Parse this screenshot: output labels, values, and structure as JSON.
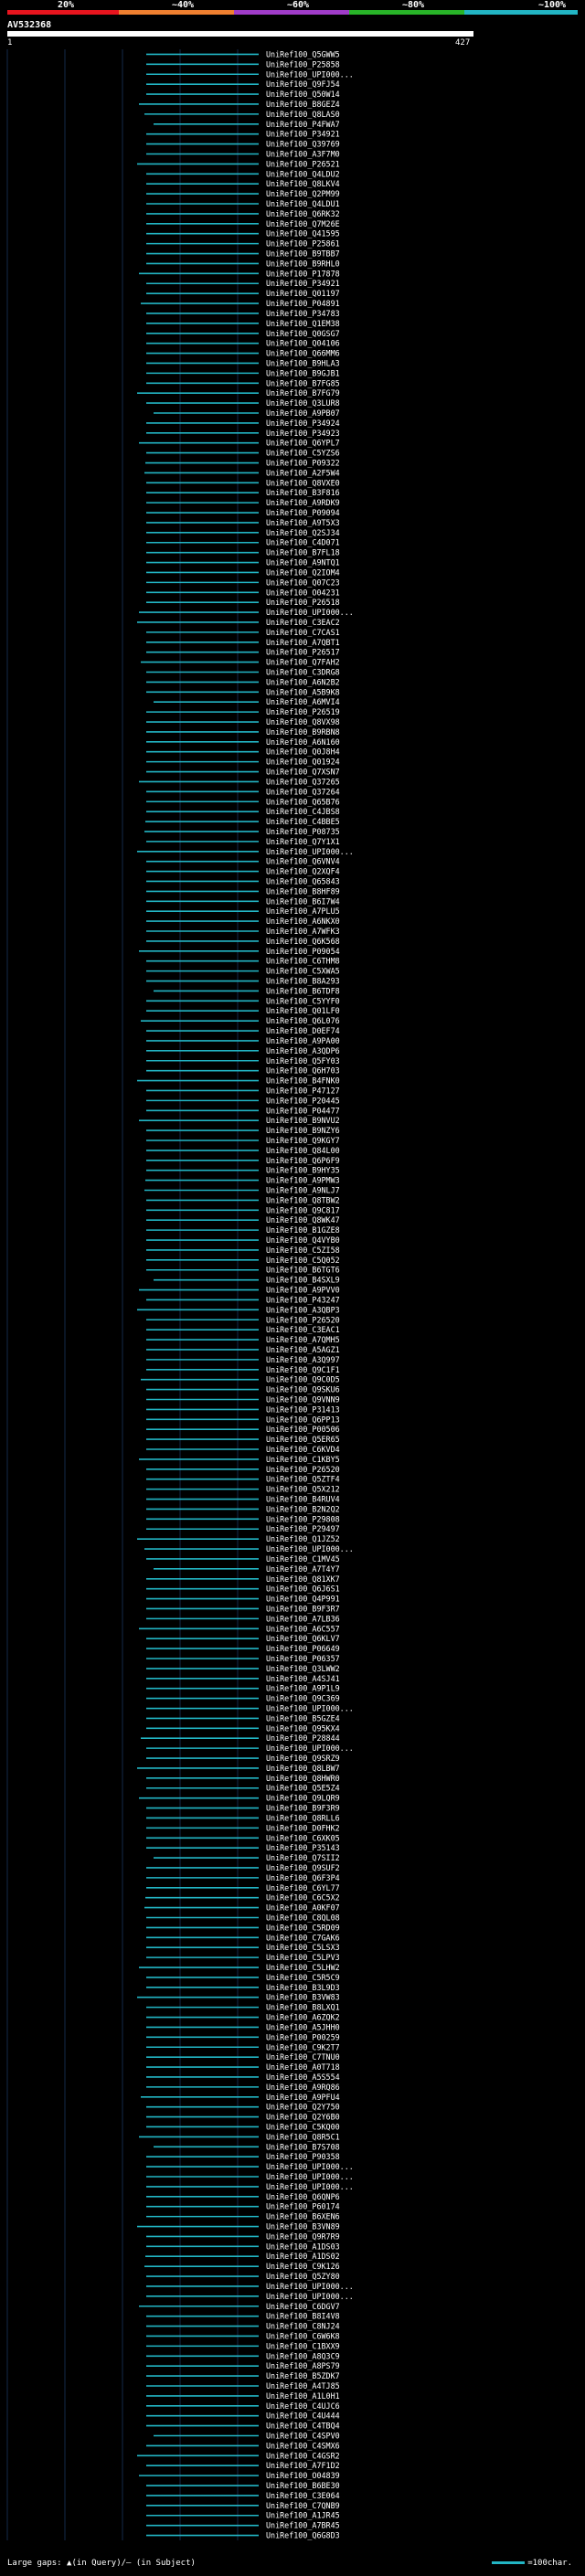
{
  "header": {
    "pct_labels": [
      "20%",
      "~40%",
      "~60%",
      "~80%",
      "~100%"
    ],
    "band_colors": [
      "#e8141e",
      "#f08030",
      "#a03cc8",
      "#28b428",
      "#22b5c4"
    ],
    "query_name": "AV532368",
    "query_start": "1",
    "query_end": "427"
  },
  "colors": {
    "hit": "#22b5c4",
    "grid": "#152a4a",
    "label": "#ffffff",
    "background": "#000000"
  },
  "footer": {
    "gaps_text": "Large gaps: ▲(in Query)/— (in Subject)",
    "legend_text": "=100char."
  },
  "hits": [
    "UniRef100_Q5GWW5",
    "UniRef100_P25858",
    "UniRef100_UPI000...",
    "UniRef100_Q9FJ54",
    "UniRef100_Q50W14",
    "UniRef100_B8GEZ4",
    "UniRef100_Q8LAS0",
    "UniRef100_P4FWA7",
    "UniRef100_P34921",
    "UniRef100_Q39769",
    "UniRef100_A3F7M0",
    "UniRef100_P26521",
    "UniRef100_Q4LDU2",
    "UniRef100_Q8LKV4",
    "UniRef100_Q2PM99",
    "UniRef100_Q4LDU1",
    "UniRef100_Q6RK32",
    "UniRef100_Q7M26E",
    "UniRef100_Q41595",
    "UniRef100_P25861",
    "UniRef100_B9TBB7",
    "UniRef100_B9RHL0",
    "UniRef100_P17878",
    "UniRef100_P34921",
    "UniRef100_Q01197",
    "UniRef100_P04891",
    "UniRef100_P34783",
    "UniRef100_Q1EM38",
    "UniRef100_Q0GSG7",
    "UniRef100_Q04106",
    "UniRef100_Q66MM6",
    "UniRef100_B9HLA3",
    "UniRef100_B9GJB1",
    "UniRef100_B7FG85",
    "UniRef100_B7FG79",
    "UniRef100_Q3LUR8",
    "UniRef100_A9PB07",
    "UniRef100_P34924",
    "UniRef100_P34923",
    "UniRef100_Q6YPL7",
    "UniRef100_C5YZS6",
    "UniRef100_P09322",
    "UniRef100_A2F5W4",
    "UniRef100_Q8VXE0",
    "UniRef100_B3F816",
    "UniRef100_A9RDK9",
    "UniRef100_P09094",
    "UniRef100_A9T5X3",
    "UniRef100_Q2SJ34",
    "UniRef100_C4D071",
    "UniRef100_B7FL18",
    "UniRef100_A9NTQ1",
    "UniRef100_Q2IOM4",
    "UniRef100_Q07C23",
    "UniRef100_O04231",
    "UniRef100_P26518",
    "UniRef100_UPI000...",
    "UniRef100_C3EAC2",
    "UniRef100_C7CAS1",
    "UniRef100_A7QBT1",
    "UniRef100_P26517",
    "UniRef100_Q7FAH2",
    "UniRef100_C3DRG8",
    "UniRef100_A6N2B2",
    "UniRef100_A5B9K8",
    "UniRef100_A6MVI4",
    "UniRef100_P26519",
    "UniRef100_Q8VX98",
    "UniRef100_B9RBN8",
    "UniRef100_A6N160",
    "UniRef100_Q0J8H4",
    "UniRef100_Q01924",
    "UniRef100_Q7XSN7",
    "UniRef100_Q37265",
    "UniRef100_Q37264",
    "UniRef100_Q65B76",
    "UniRef100_C4JBS8",
    "UniRef100_C4BBE5",
    "UniRef100_P08735",
    "UniRef100_Q7Y1X1",
    "UniRef100_UPI000...",
    "UniRef100_Q6VNV4",
    "UniRef100_Q2XQF4",
    "UniRef100_Q65843",
    "UniRef100_B8HF89",
    "UniRef100_B6I7W4",
    "UniRef100_A7PLU5",
    "UniRef100_A6NKX0",
    "UniRef100_A7WFK3",
    "UniRef100_Q6K568",
    "UniRef100_P09054",
    "UniRef100_C6THM8",
    "UniRef100_C5XWA5",
    "UniRef100_B8A293",
    "UniRef100_B6TDF8",
    "UniRef100_C5YYF0",
    "UniRef100_Q01LF0",
    "UniRef100_Q6L076",
    "UniRef100_D0EF74",
    "UniRef100_A9PA00",
    "UniRef100_A3QDP6",
    "UniRef100_Q5FY03",
    "UniRef100_Q6H703",
    "UniRef100_B4FNK0",
    "UniRef100_P47127",
    "UniRef100_P20445",
    "UniRef100_P04477",
    "UniRef100_B9NVU2",
    "UniRef100_B9NZY6",
    "UniRef100_Q9KGY7",
    "UniRef100_Q84L00",
    "UniRef100_Q6P6F9",
    "UniRef100_B9HY35",
    "UniRef100_A9PMW3",
    "UniRef100_A9NLJ7",
    "UniRef100_Q8TBW2",
    "UniRef100_Q9C817",
    "UniRef100_Q8WK47",
    "UniRef100_B1GZE8",
    "UniRef100_Q4VYB0",
    "UniRef100_C5ZI58",
    "UniRef100_C5Q052",
    "UniRef100_B6TGT6",
    "UniRef100_B4SXL9",
    "UniRef100_A9PVV0",
    "UniRef100_P43247",
    "UniRef100_A3QBP3",
    "UniRef100_P26520",
    "UniRef100_C3EAC1",
    "UniRef100_A7QMH5",
    "UniRef100_A5AGZ1",
    "UniRef100_A3Q997",
    "UniRef100_Q9C1F1",
    "UniRef100_Q9C0D5",
    "UniRef100_Q9SKU6",
    "UniRef100_Q9VNN9",
    "UniRef100_P31413",
    "UniRef100_Q6PP13",
    "UniRef100_P00506",
    "UniRef100_Q5ER65",
    "UniRef100_C6KVD4",
    "UniRef100_C1KBY5",
    "UniRef100_P26520",
    "UniRef100_Q5ZTF4",
    "UniRef100_Q5X212",
    "UniRef100_B4RUV4",
    "UniRef100_B2N2Q2",
    "UniRef100_P29808",
    "UniRef100_P29497",
    "UniRef100_Q1JZ52",
    "UniRef100_UPI000...",
    "UniRef100_C1MV45",
    "UniRef100_A7T4Y7",
    "UniRef100_Q81XK7",
    "UniRef100_Q6J6S1",
    "UniRef100_Q4P991",
    "UniRef100_B9F3R7",
    "UniRef100_A7LB36",
    "UniRef100_A6C557",
    "UniRef100_Q6KLV7",
    "UniRef100_P06649",
    "UniRef100_P06357",
    "UniRef100_Q3LWW2",
    "UniRef100_A4SJ41",
    "UniRef100_A9P1L9",
    "UniRef100_Q9C369",
    "UniRef100_UPI000...",
    "UniRef100_B5GZE4",
    "UniRef100_Q95KX4",
    "UniRef100_P28844",
    "UniRef100_UPI000...",
    "UniRef100_Q9SRZ9",
    "UniRef100_Q8LBW7",
    "UniRef100_Q8HWR0",
    "UniRef100_Q5E5Z4",
    "UniRef100_Q9LQR9",
    "UniRef100_B9F3R9",
    "UniRef100_Q8RLL6",
    "UniRef100_D0FHK2",
    "UniRef100_C6XK05",
    "UniRef100_P35143",
    "UniRef100_Q7SII2",
    "UniRef100_Q9SUF2",
    "UniRef100_Q6F3P4",
    "UniRef100_C6YL77",
    "UniRef100_C6C5X2",
    "UniRef100_A0KF07",
    "UniRef100_C8QL08",
    "UniRef100_C5RD09",
    "UniRef100_C7GAK6",
    "UniRef100_C5LSX3",
    "UniRef100_C5LPV3",
    "UniRef100_C5LHW2",
    "UniRef100_C5R5C9",
    "UniRef100_B3L9D3",
    "UniRef100_B3VW83",
    "UniRef100_B8LXQ1",
    "UniRef100_A6ZQK2",
    "UniRef100_A5JHH0",
    "UniRef100_P00259",
    "UniRef100_C9K2T7",
    "UniRef100_C7TNU0",
    "UniRef100_A0T718",
    "UniRef100_A5S554",
    "UniRef100_A9RQ86",
    "UniRef100_A9PFU4",
    "UniRef100_Q2Y750",
    "UniRef100_Q2Y6B0",
    "UniRef100_C5KQ00",
    "UniRef100_Q8R5C1",
    "UniRef100_B7S708",
    "UniRef100_P90358",
    "UniRef100_UPI000...",
    "UniRef100_UPI000...",
    "UniRef100_UPI000...",
    "UniRef100_Q6QNP6",
    "UniRef100_P60174",
    "UniRef100_B6XEN6",
    "UniRef100_B3VN89",
    "UniRef100_Q9R7R9",
    "UniRef100_A1DS03",
    "UniRef100_A1DS02",
    "UniRef100_C9K126",
    "UniRef100_Q5ZY80",
    "UniRef100_UPI000...",
    "UniRef100_UPI000...",
    "UniRef100_C6DGV7",
    "UniRef100_B8I4V8",
    "UniRef100_C8NJ24",
    "UniRef100_C6W6K8",
    "UniRef100_C1BXX9",
    "UniRef100_A8Q3C9",
    "UniRef100_A8PS79",
    "UniRef100_B5ZDK7",
    "UniRef100_A4TJ85",
    "UniRef100_A1L0H1",
    "UniRef100_C4UJC6",
    "UniRef100_C4U444",
    "UniRef100_C4TBQ4",
    "UniRef100_C4SPV0",
    "UniRef100_C4SMX6",
    "UniRef100_C4GSR2",
    "UniRef100_A7F1D2",
    "UniRef100_O04839",
    "UniRef100_B6BE30",
    "UniRef100_C3E064",
    "UniRef100_C7QNB9",
    "UniRef100_A1JR45",
    "UniRef100_A7BR45",
    "UniRef100_Q6G8D3"
  ]
}
